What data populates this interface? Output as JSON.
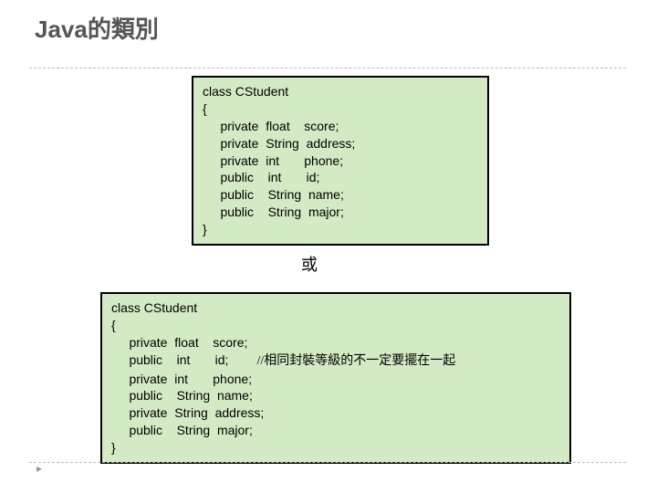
{
  "title": "Java的類別",
  "separator": "或",
  "bullet": "▸",
  "box1": {
    "l1": "class CStudent",
    "l2": "{",
    "l3": "     private  float    score;",
    "l4": "     private  String  address;",
    "l5": "     private  int       phone;",
    "l6": "     public    int       id;",
    "l7": "     public    String  name;",
    "l8": "     public    String  major;",
    "l9": "}"
  },
  "box2": {
    "l1": "class CStudent",
    "l2": "{",
    "l3": "     private  float    score;",
    "l4a": "     public    int       id;        ",
    "l4b": "//相同封裝等級的不一定要擺在一起",
    "l5": "     private  int       phone;",
    "l6": "     public    String  name;",
    "l7": "     private  String  address;",
    "l8": "     public    String  major;",
    "l9": "}"
  }
}
